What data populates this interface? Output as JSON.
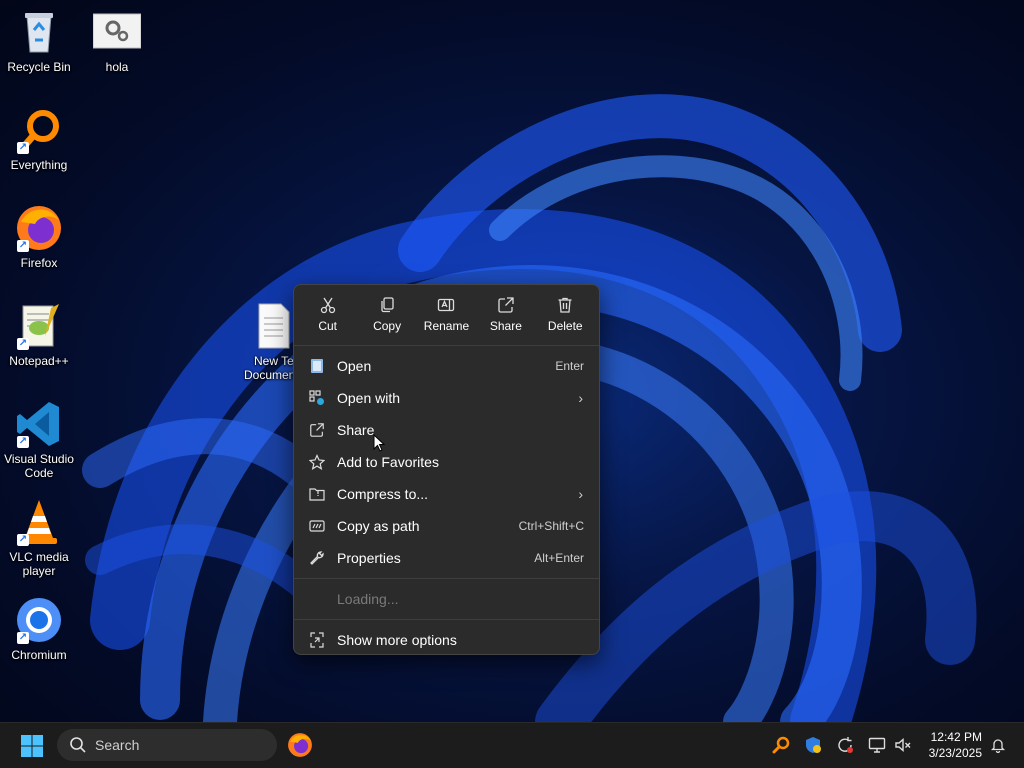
{
  "desktop": {
    "icons": [
      {
        "label": "Recycle Bin",
        "icon": "recycle-bin-icon"
      },
      {
        "label": "hola",
        "icon": "settings-file-icon"
      },
      {
        "label": "Everything",
        "icon": "everything-search-icon"
      },
      {
        "label": "Firefox",
        "icon": "firefox-icon"
      },
      {
        "label": "Notepad++",
        "icon": "notepadpp-icon"
      },
      {
        "label": "Visual Studio Code",
        "icon": "vscode-icon"
      },
      {
        "label": "VLC media player",
        "icon": "vlc-icon"
      },
      {
        "label": "Chromium",
        "icon": "chromium-icon"
      },
      {
        "label": "New Text Document",
        "icon": "text-document-icon"
      }
    ],
    "partial_file_label_line1": "New Tex",
    "partial_file_label_line2": "Documen"
  },
  "context_menu": {
    "quick_actions": [
      {
        "label": "Cut",
        "icon": "scissors-icon"
      },
      {
        "label": "Copy",
        "icon": "copy-icon"
      },
      {
        "label": "Rename",
        "icon": "rename-icon"
      },
      {
        "label": "Share",
        "icon": "share-icon"
      },
      {
        "label": "Delete",
        "icon": "trash-icon"
      }
    ],
    "items": [
      {
        "label": "Open",
        "shortcut": "Enter",
        "icon": "notepad-icon"
      },
      {
        "label": "Open with",
        "shortcut": "",
        "icon": "open-with-icon",
        "submenu": true
      },
      {
        "label": "Share",
        "shortcut": "",
        "icon": "share-icon"
      },
      {
        "label": "Add to Favorites",
        "shortcut": "",
        "icon": "star-icon"
      },
      {
        "label": "Compress to...",
        "shortcut": "",
        "icon": "zip-folder-icon",
        "submenu": true
      },
      {
        "label": "Copy as path",
        "shortcut": "Ctrl+Shift+C",
        "icon": "copy-path-icon"
      },
      {
        "label": "Properties",
        "shortcut": "Alt+Enter",
        "icon": "wrench-icon"
      }
    ],
    "loading_label": "Loading...",
    "more_label": "Show more options",
    "submenu_arrow": "›"
  },
  "taskbar": {
    "search_placeholder": "Search",
    "time": "12:42 PM",
    "date": "3/23/2025"
  },
  "colors": {
    "menu_bg": "#2b2b2b",
    "taskbar_bg": "#1c1c1c",
    "accent": "#4cc2ff"
  }
}
